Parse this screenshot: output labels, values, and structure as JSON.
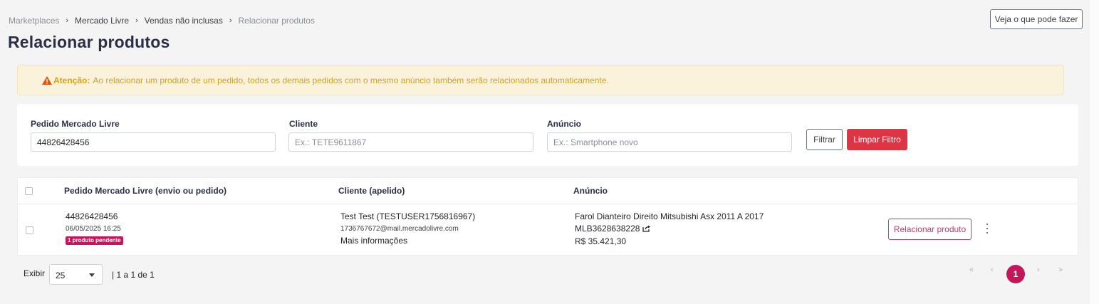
{
  "breadcrumb": {
    "items": [
      "Marketplaces",
      "Mercado Livre",
      "Vendas não inclusas",
      "Relacionar produtos"
    ],
    "separator": "›"
  },
  "header": {
    "title": "Relacionar produtos",
    "help_button": "Veja o que pode fazer"
  },
  "alert": {
    "icon": "warning-triangle-icon",
    "strong": "Atenção:",
    "text": "Ao relacionar um produto de um pedido, todos os demais pedidos com o mesmo anúncio também serão relacionados automaticamente."
  },
  "filters": {
    "pedido": {
      "label": "Pedido Mercado Livre",
      "value": "44826428456",
      "placeholder": ""
    },
    "cliente": {
      "label": "Cliente",
      "value": "",
      "placeholder": "Ex.: TETE9611867"
    },
    "anuncio": {
      "label": "Anúncio",
      "value": "",
      "placeholder": "Ex.: Smartphone novo"
    },
    "filter_button": "Filtrar",
    "clear_button": "Limpar Filtro"
  },
  "table": {
    "headers": [
      "Pedido Mercado Livre (envio ou pedido)",
      "Cliente (apelido)",
      "Anúncio"
    ],
    "rows": [
      {
        "order_id": "44826428456",
        "date": "06/05/2025 16:25",
        "badge": "1 produto pendente",
        "client_name": "Test Test (TESTUSER1756816967)",
        "client_email": "1736767672@mail.mercadolivre.com",
        "client_more": "Mais informações",
        "ad_title": "Farol Dianteiro Direito Mitsubishi Asx 2011 A 2017",
        "ad_code": "MLB3628638228",
        "ad_price": "R$ 35.421,30",
        "action_button": "Relacionar produto"
      }
    ]
  },
  "footer": {
    "show_label": "Exibir",
    "page_size": "25",
    "range": "| 1 a 1 de 1",
    "pagination": {
      "first": "«",
      "prev": "‹",
      "current": "1",
      "next": "›",
      "last": "»"
    }
  },
  "colors": {
    "accent": "#c2185b",
    "danger": "#dc3545",
    "warning_text": "#c9a227",
    "warning_bg": "#fbf2dc"
  }
}
